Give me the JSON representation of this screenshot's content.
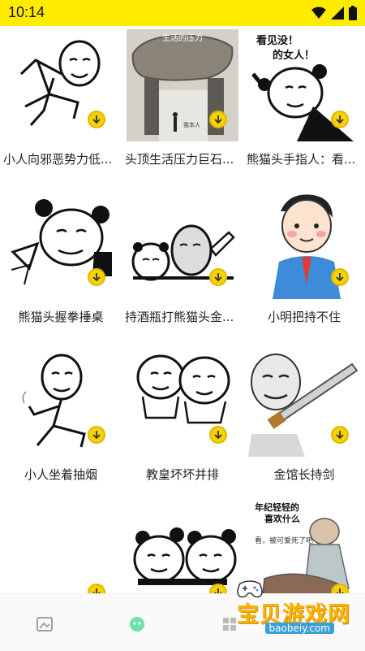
{
  "status": {
    "time": "10:14"
  },
  "items": [
    {
      "caption": "小人向邪恶势力低..."
    },
    {
      "caption": "头顶生活压力巨石...",
      "overlay_title": "生活的压力",
      "overlay_sub": "我本人"
    },
    {
      "caption": "熊猫头手指人：看...",
      "overlay_title": "看见没！\n的女人！"
    },
    {
      "caption": "熊猫头握拳捶桌"
    },
    {
      "caption": "持酒瓶打熊猫头金..."
    },
    {
      "caption": "小明把持不住"
    },
    {
      "caption": "小人坐着抽烟"
    },
    {
      "caption": "教皇坏坏并排"
    },
    {
      "caption": "金馆长持剑"
    },
    {
      "caption": ""
    },
    {
      "caption": ""
    },
    {
      "caption": "",
      "overlay_title": "年纪轻轻的\n喜欢什么",
      "overlay_sub": "看，被可爱死了吧"
    }
  ],
  "watermark": {
    "text": "宝贝游戏网",
    "url": "baobeiy.com"
  },
  "nav": {
    "icons": [
      "image-icon",
      "emoji-icon",
      "grid-icon"
    ]
  }
}
